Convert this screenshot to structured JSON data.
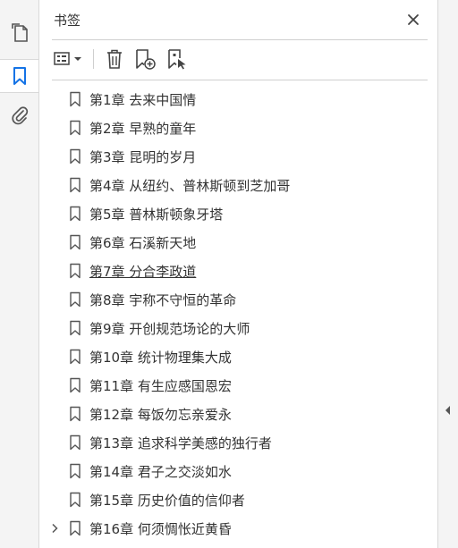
{
  "left_rail": {
    "icons": [
      "page-thumbnails-icon",
      "bookmark-icon",
      "attachment-icon"
    ],
    "active": "bookmark-icon",
    "accent_color": "#1473e6"
  },
  "panel": {
    "title": "书签",
    "close_icon": "close-icon"
  },
  "toolbar": {
    "icons": [
      "options-menu-icon",
      "delete-bookmark-icon",
      "new-bookmark-icon",
      "bookmark-from-selection-icon"
    ]
  },
  "bookmarks": [
    {
      "label": "第1章  去来中国情"
    },
    {
      "label": "第2章  早熟的童年"
    },
    {
      "label": "第3章  昆明的岁月"
    },
    {
      "label": "第4章  从纽约、普林斯顿到芝加哥"
    },
    {
      "label": "第5章  普林斯顿象牙塔"
    },
    {
      "label": "第6章  石溪新天地"
    },
    {
      "label": "第7章  分合李政道"
    },
    {
      "label": "第8章  宇称不守恒的革命"
    },
    {
      "label": "第9章  开创规范场论的大师"
    },
    {
      "label": "第10章  统计物理集大成"
    },
    {
      "label": "第11章  有生应感国恩宏"
    },
    {
      "label": "第12章  每饭勿忘亲爱永"
    },
    {
      "label": "第13章  追求科学美感的独行者"
    },
    {
      "label": "第14章  君子之交淡如水"
    },
    {
      "label": "第15章  历史价值的信仰者"
    },
    {
      "label": "第16章  何须惆怅近黄昏"
    }
  ],
  "right_rail": {
    "collapse_icon": "collapse-arrow-icon"
  }
}
